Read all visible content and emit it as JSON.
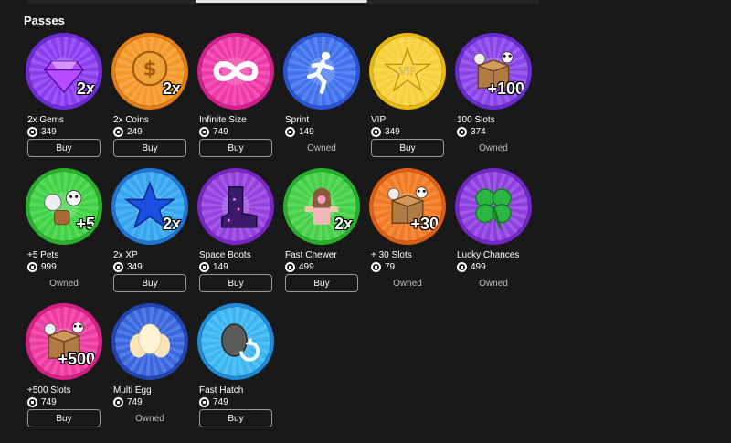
{
  "section": {
    "title": "Passes"
  },
  "passes": [
    {
      "name": "2x Gems",
      "price": "349",
      "action": "Buy",
      "owned": false,
      "icon": "diamond-gem-icon",
      "ring": "#6d2bd9",
      "bg": "#8b3df0",
      "mult": "2x"
    },
    {
      "name": "2x Coins",
      "price": "249",
      "action": "Buy",
      "owned": false,
      "icon": "coin-icon",
      "ring": "#e67d13",
      "bg": "#f59a2a",
      "mult": "2x"
    },
    {
      "name": "Infinite Size",
      "price": "749",
      "action": "Buy",
      "owned": false,
      "icon": "infinity-icon",
      "ring": "#d61f8f",
      "bg": "#ef3aa9",
      "mult": ""
    },
    {
      "name": "Sprint",
      "price": "149",
      "action": "Owned",
      "owned": true,
      "icon": "running-man-icon",
      "ring": "#2a55d6",
      "bg": "#3f72ee",
      "mult": ""
    },
    {
      "name": "VIP",
      "price": "349",
      "action": "Buy",
      "owned": false,
      "icon": "vip-star-icon",
      "ring": "#e9b910",
      "bg": "#f7d13a",
      "mult": ""
    },
    {
      "name": "100 Slots",
      "price": "374",
      "action": "Owned",
      "owned": true,
      "icon": "pet-box-icon",
      "ring": "#6a2bd0",
      "bg": "#8a44ea",
      "mult": "+100"
    },
    {
      "name": "+5 Pets",
      "price": "999",
      "action": "Owned",
      "owned": true,
      "icon": "pets-group-icon",
      "ring": "#29b12e",
      "bg": "#3fd243",
      "mult": "+5"
    },
    {
      "name": "2x XP",
      "price": "349",
      "action": "Buy",
      "owned": false,
      "icon": "blue-star-icon",
      "ring": "#1f74d8",
      "bg": "#35a6f2",
      "mult": "2x"
    },
    {
      "name": "Space Boots",
      "price": "149",
      "action": "Buy",
      "owned": false,
      "icon": "space-boot-icon",
      "ring": "#7a25c9",
      "bg": "#9540e0",
      "mult": ""
    },
    {
      "name": "Fast Chewer",
      "price": "499",
      "action": "Buy",
      "owned": false,
      "icon": "avatar-icon",
      "ring": "#26b12b",
      "bg": "#44d148",
      "mult": "2x"
    },
    {
      "name": "+ 30 Slots",
      "price": "79",
      "action": "Owned",
      "owned": true,
      "icon": "pet-box-icon",
      "ring": "#e05d12",
      "bg": "#f27a22",
      "mult": "+30"
    },
    {
      "name": "Lucky Chances",
      "price": "499",
      "action": "Owned",
      "owned": true,
      "icon": "clover-icon",
      "ring": "#7326c9",
      "bg": "#8f3fe0",
      "mult": ""
    },
    {
      "name": "+500 Slots",
      "price": "749",
      "action": "Buy",
      "owned": false,
      "icon": "pet-box-icon",
      "ring": "#d71f86",
      "bg": "#ef3aa3",
      "mult": "+500"
    },
    {
      "name": "Multi Egg",
      "price": "749",
      "action": "Owned",
      "owned": true,
      "icon": "eggs-icon",
      "ring": "#2244b8",
      "bg": "#3867df",
      "mult": ""
    },
    {
      "name": "Fast Hatch",
      "price": "749",
      "action": "Buy",
      "owned": false,
      "icon": "egg-rotate-icon",
      "ring": "#1e8ad8",
      "bg": "#3bb6f3",
      "mult": ""
    }
  ]
}
